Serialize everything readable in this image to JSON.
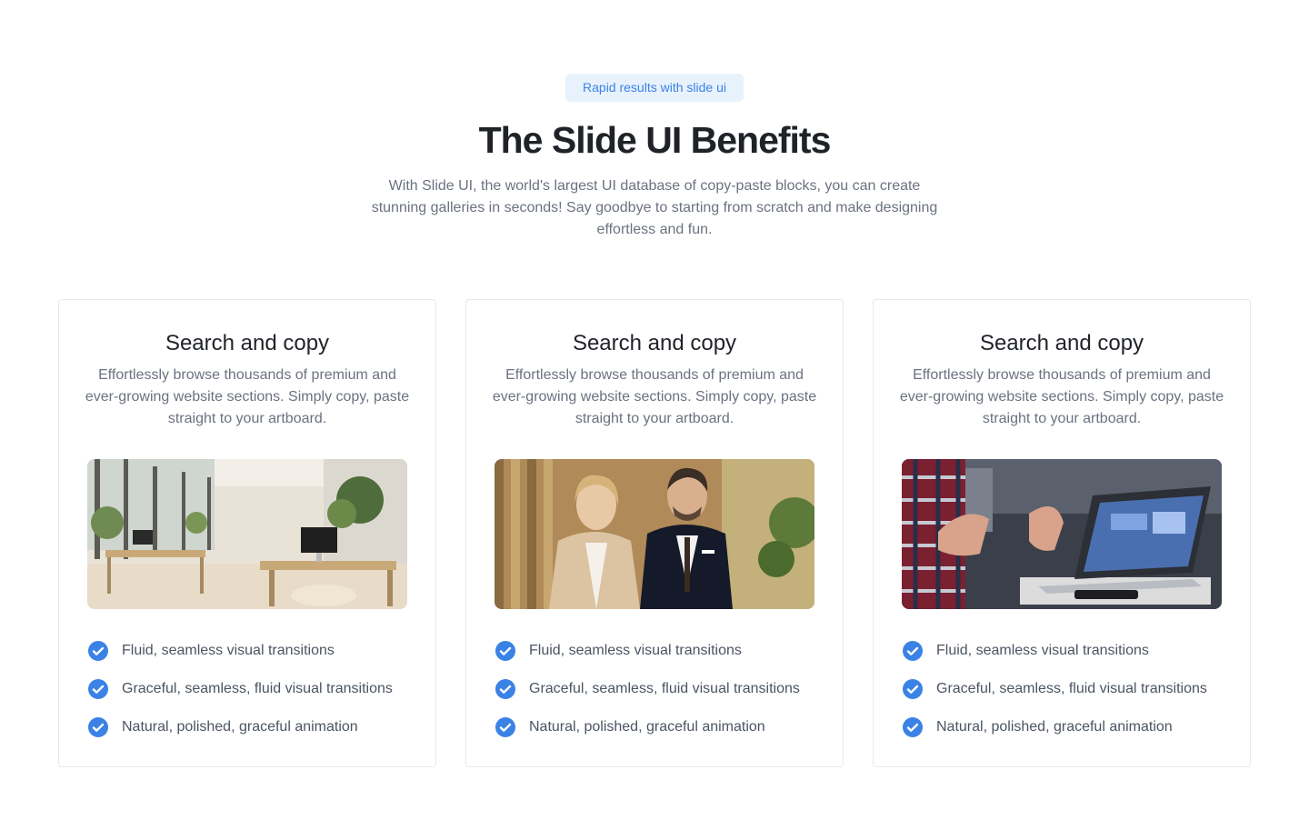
{
  "header": {
    "badge": "Rapid results with slide ui",
    "title": "The Slide UI Benefits",
    "subtitle": "With Slide UI, the world's largest UI database of copy-paste blocks, you can create stunning galleries in seconds! Say goodbye to starting from scratch and make designing effortless and fun."
  },
  "colors": {
    "accent": "#3b82e6",
    "badge_bg": "#e8f2fd",
    "check": "#3b82e6"
  },
  "cards": [
    {
      "title": "Search and copy",
      "description": "Effortlessly browse thousands of premium and ever-growing website sections. Simply copy, paste straight to your artboard.",
      "image": "office-interior-photo",
      "features": [
        "Fluid, seamless visual transitions",
        "Graceful, seamless, fluid visual transitions",
        "Natural, polished, graceful animation"
      ]
    },
    {
      "title": "Search and copy",
      "description": "Effortlessly browse thousands of premium and ever-growing website sections. Simply copy, paste straight to your artboard.",
      "image": "business-people-photo",
      "features": [
        "Fluid, seamless visual transitions",
        "Graceful, seamless, fluid visual transitions",
        "Natural, polished, graceful animation"
      ]
    },
    {
      "title": "Search and copy",
      "description": "Effortlessly browse thousands of premium and ever-growing website sections. Simply copy, paste straight to your artboard.",
      "image": "laptop-meeting-photo",
      "features": [
        "Fluid, seamless visual transitions",
        "Graceful, seamless, fluid visual transitions",
        "Natural, polished, graceful animation"
      ]
    }
  ]
}
